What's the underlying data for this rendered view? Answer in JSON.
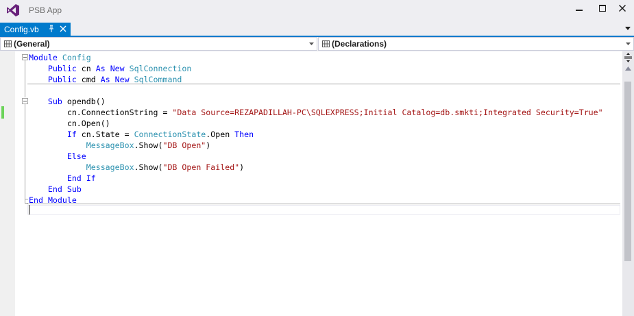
{
  "window": {
    "title": "PSB App",
    "accent_color": "#007acc",
    "minimize_icon": "minimize-icon",
    "maximize_icon": "maximize-icon",
    "close_icon": "close-icon"
  },
  "tabs": [
    {
      "label": "Config.vb",
      "active": true,
      "pin_icon": "pin-icon",
      "close_icon": "close-icon"
    }
  ],
  "navigation": {
    "left_combo": "(General)",
    "right_combo": "(Declarations)"
  },
  "code": {
    "lines": [
      [
        {
          "t": "Module",
          "c": "kw"
        },
        {
          "t": " "
        },
        {
          "t": "Config",
          "c": "ty"
        }
      ],
      [
        {
          "t": "    "
        },
        {
          "t": "Public",
          "c": "kw"
        },
        {
          "t": " cn "
        },
        {
          "t": "As",
          "c": "kw"
        },
        {
          "t": " "
        },
        {
          "t": "New",
          "c": "kw"
        },
        {
          "t": " "
        },
        {
          "t": "SqlConnection",
          "c": "ty"
        }
      ],
      [
        {
          "t": "    "
        },
        {
          "t": "Public",
          "c": "kw"
        },
        {
          "t": " cmd "
        },
        {
          "t": "As",
          "c": "kw"
        },
        {
          "t": " "
        },
        {
          "t": "New",
          "c": "kw"
        },
        {
          "t": " "
        },
        {
          "t": "SqlCommand",
          "c": "ty"
        }
      ],
      [],
      [
        {
          "t": "    "
        },
        {
          "t": "Sub",
          "c": "kw"
        },
        {
          "t": " opendb()"
        }
      ],
      [
        {
          "t": "        cn.ConnectionString = "
        },
        {
          "t": "\"Data Source=REZAPADILLAH-PC\\SQLEXPRESS;Initial Catalog=db.smkti;Integrated Security=True\"",
          "c": "str"
        }
      ],
      [
        {
          "t": "        cn.Open()"
        }
      ],
      [
        {
          "t": "        "
        },
        {
          "t": "If",
          "c": "kw"
        },
        {
          "t": " cn.State = "
        },
        {
          "t": "ConnectionState",
          "c": "ty"
        },
        {
          "t": ".Open "
        },
        {
          "t": "Then",
          "c": "kw"
        }
      ],
      [
        {
          "t": "            "
        },
        {
          "t": "MessageBox",
          "c": "ty"
        },
        {
          "t": ".Show("
        },
        {
          "t": "\"DB Open\"",
          "c": "str"
        },
        {
          "t": ")"
        }
      ],
      [
        {
          "t": "        "
        },
        {
          "t": "Else",
          "c": "kw"
        }
      ],
      [
        {
          "t": "            "
        },
        {
          "t": "MessageBox",
          "c": "ty"
        },
        {
          "t": ".Show("
        },
        {
          "t": "\"DB Open Failed\"",
          "c": "str"
        },
        {
          "t": ")"
        }
      ],
      [
        {
          "t": "        "
        },
        {
          "t": "End",
          "c": "kw"
        },
        {
          "t": " "
        },
        {
          "t": "If",
          "c": "kw"
        }
      ],
      [
        {
          "t": "    "
        },
        {
          "t": "End",
          "c": "kw"
        },
        {
          "t": " "
        },
        {
          "t": "Sub",
          "c": "kw"
        }
      ],
      [
        {
          "t": "End",
          "c": "kw"
        },
        {
          "t": " "
        },
        {
          "t": "Module",
          "c": "kw"
        }
      ]
    ],
    "colors": {
      "keyword": "#0000ff",
      "type": "#2b91af",
      "string": "#a31515",
      "plain": "#000000"
    }
  },
  "scrollbar": {
    "split_icon": "split-icon",
    "up_arrow_icon": "up-arrow-icon"
  }
}
